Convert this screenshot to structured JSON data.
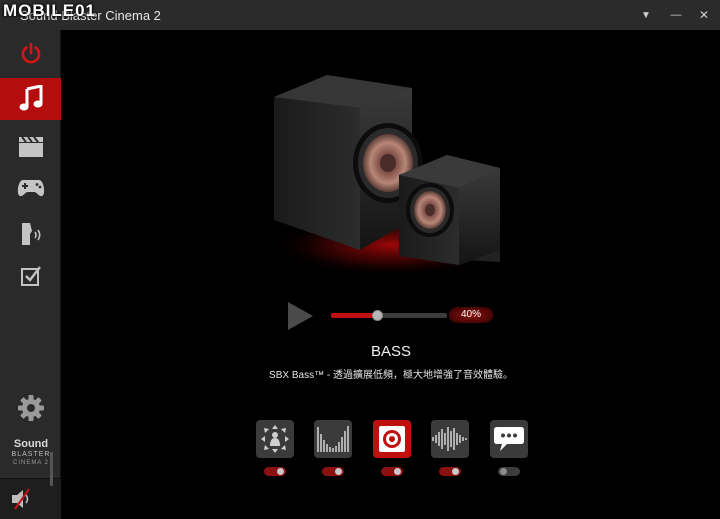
{
  "window": {
    "title": "Sound Blaster Cinema 2",
    "watermark": "MOBILE01",
    "minimize_glyph": "—",
    "close_glyph": "✕",
    "dropdown_glyph": "▼"
  },
  "sidebar": {
    "items": [
      {
        "name": "power",
        "icon": "power-icon",
        "active": false
      },
      {
        "name": "music",
        "icon": "music-note-icon",
        "active": true
      },
      {
        "name": "movie",
        "icon": "clapperboard-icon",
        "active": false
      },
      {
        "name": "game",
        "icon": "gamepad-icon",
        "active": false
      },
      {
        "name": "voice",
        "icon": "voice-icon",
        "active": false
      },
      {
        "name": "custom",
        "icon": "checkbox-icon",
        "active": false
      }
    ],
    "settings_icon": "gear-icon",
    "brand": {
      "line1": "Sound",
      "line2": "BLASTER",
      "line3": "CINEMA 2"
    },
    "volume_icon": "speaker-mute-icon"
  },
  "main": {
    "slider": {
      "value": 0.4,
      "label": "40%"
    },
    "feature_title": "BASS",
    "feature_desc": "SBX Bass™ - 透過擴展低頻，極大地增強了音效體驗。",
    "features": [
      {
        "name": "surround",
        "icon": "surround-icon",
        "active": false,
        "enabled": true
      },
      {
        "name": "crystalizer",
        "icon": "equalizer-bars-icon",
        "active": false,
        "enabled": true
      },
      {
        "name": "bass",
        "icon": "subwoofer-icon",
        "active": true,
        "enabled": true
      },
      {
        "name": "smart-volume",
        "icon": "waveform-icon",
        "active": false,
        "enabled": true
      },
      {
        "name": "dialog-plus",
        "icon": "speech-bubble-icon",
        "active": false,
        "enabled": false
      }
    ]
  },
  "colors": {
    "accent": "#c00f0f",
    "sidebar": "#2a2a2a",
    "background": "#000000"
  }
}
